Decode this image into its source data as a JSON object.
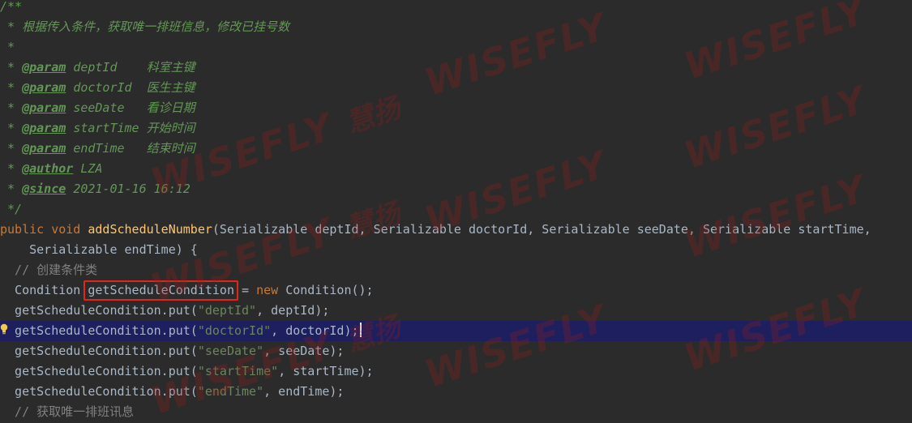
{
  "editor": {
    "comment": {
      "open": "/**",
      "summary": " * 根据传入条件，获取唯一排班信息，修改已挂号数",
      "blank": " *",
      "star": " * ",
      "params": [
        {
          "tag": "@param",
          "name": "deptId",
          "pad": "    ",
          "desc": "科室主键"
        },
        {
          "tag": "@param",
          "name": "doctorId",
          "pad": "  ",
          "desc": "医生主键"
        },
        {
          "tag": "@param",
          "name": "seeDate",
          "pad": "   ",
          "desc": "看诊日期"
        },
        {
          "tag": "@param",
          "name": "startTime",
          "pad": " ",
          "desc": "开始时间"
        },
        {
          "tag": "@param",
          "name": "endTime",
          "pad": "   ",
          "desc": "结束时间"
        }
      ],
      "author_tag": "@author",
      "author": "LZA",
      "since_tag": "@since",
      "since": "2021-01-16 16:12",
      "close": " */"
    },
    "signature": {
      "public": "public",
      "void": "void",
      "method": "addScheduleNumber",
      "part1": "(Serializable deptId, Serializable doctorId, Serializable seeDate, Serializable startTime,",
      "part2": "    Serializable endTime) {"
    },
    "line_comment_1": "  // 创建条件类",
    "decl": {
      "type": "  Condition ",
      "var": "getScheduleCondition",
      "assign": " = ",
      "new": "new",
      "ctor": " Condition();"
    },
    "puts": [
      {
        "prefix": "  getScheduleCondition.put(",
        "key": "\"deptId\"",
        "arg": ", deptId);"
      },
      {
        "prefix": "  getScheduleCondition.put(",
        "key": "\"doctorId\"",
        "arg": ", doctorId);"
      },
      {
        "prefix": "  getScheduleCondition.put(",
        "key": "\"seeDate\"",
        "arg": ", seeDate);"
      },
      {
        "prefix": "  getScheduleCondition.put(",
        "key": "\"startTime\"",
        "arg": ", startTime);"
      },
      {
        "prefix": "  getScheduleCondition.put(",
        "key": "\"endTime\"",
        "arg": ", endTime);"
      }
    ],
    "line_comment_2": "  // 获取唯一排班讯息"
  },
  "watermark": {
    "text": "WISEFLY",
    "cn": "慧扬"
  },
  "colors": {
    "background": "#2b2b2b",
    "current_line": "#1e1f5e",
    "highlight_box": "#e3251b",
    "comment": "#629755",
    "keyword": "#cc7832",
    "method": "#ffc66d",
    "string": "#6a8759"
  },
  "icons": {
    "gutter": "lightbulb-icon"
  }
}
